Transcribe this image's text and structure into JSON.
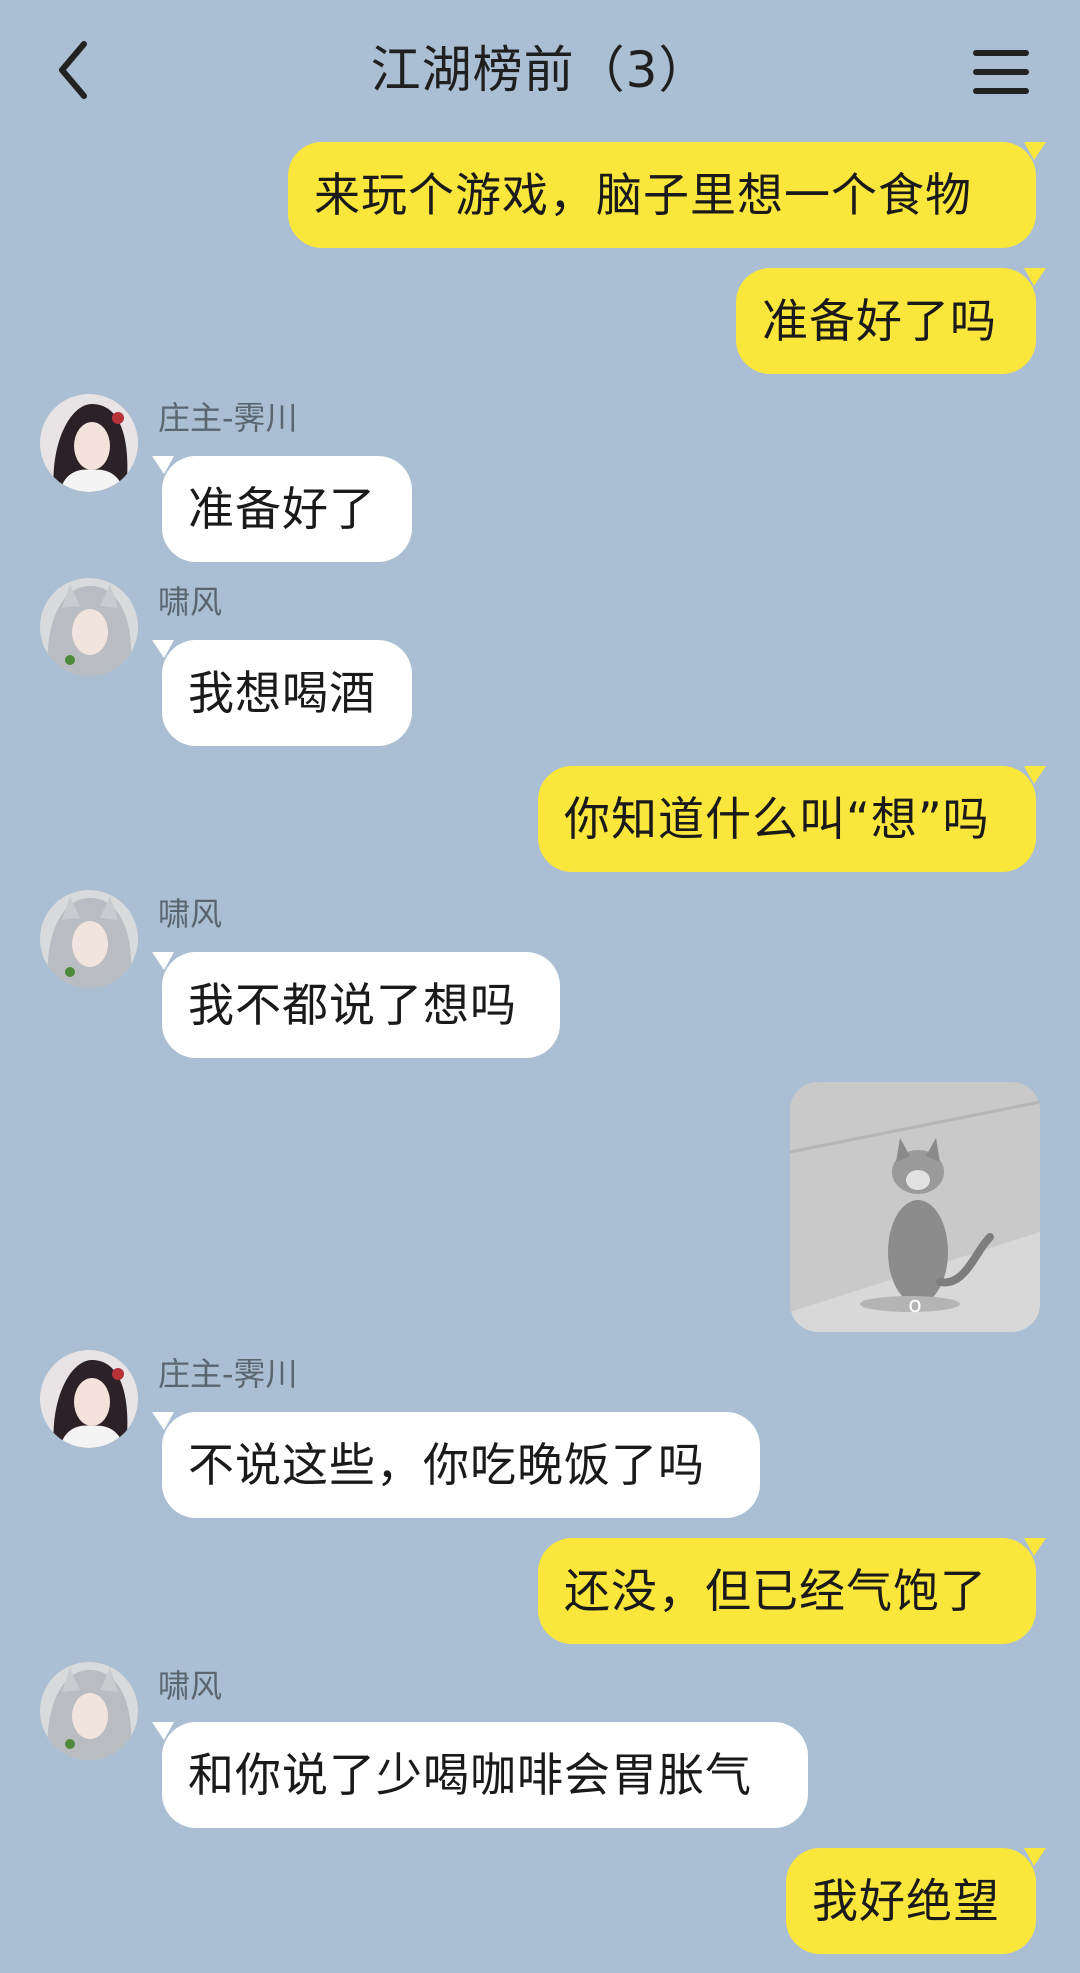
{
  "header": {
    "title": "江湖榜前（3）"
  },
  "senders": {
    "zhuangzhu": "庄主-霁川",
    "xiaofeng": "啸风"
  },
  "messages": [
    {
      "text": "来玩个游戏，脑子里想一个食物"
    },
    {
      "text": "准备好了吗"
    },
    {
      "text": "准备好了"
    },
    {
      "text": "我想喝酒"
    },
    {
      "text": "你知道什么叫“想”吗"
    },
    {
      "text": "我不都说了想吗"
    },
    {
      "text": "不说这些，你吃晚饭了吗"
    },
    {
      "text": "还没，但已经气饱了"
    },
    {
      "text": "和你说了少喝咖啡会胃胀气"
    },
    {
      "text": "我好绝望"
    }
  ],
  "sticker": {
    "caption": "o"
  },
  "colors": {
    "background": "#aabfd3",
    "outgoing": "#fbe63c",
    "incoming": "#ffffff"
  }
}
